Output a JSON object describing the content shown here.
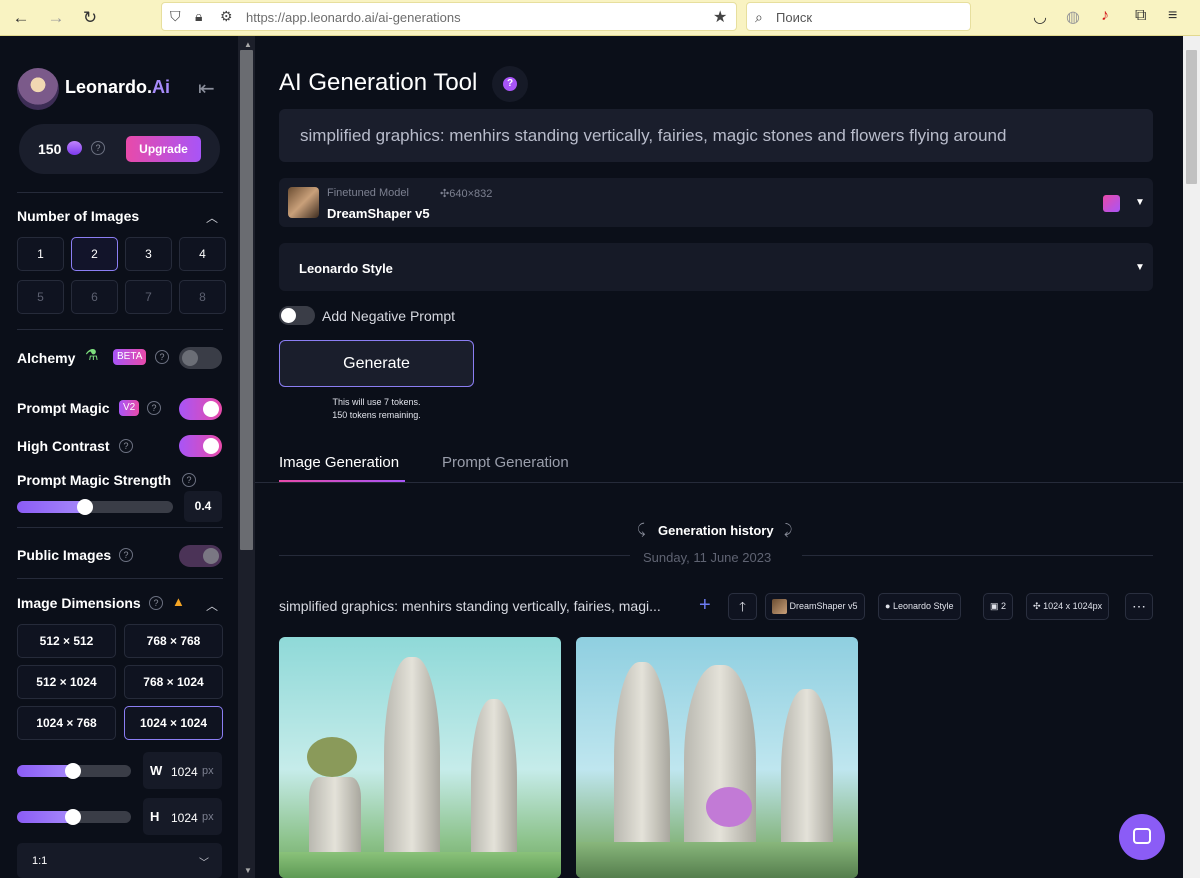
{
  "browser": {
    "url": "https://app.leonardo.ai/ai-generations",
    "search_placeholder": "Поиск"
  },
  "sidebar": {
    "brand_name": "Leonardo.",
    "brand_suffix": "Ai",
    "tokens": "150",
    "upgrade_label": "Upgrade",
    "num_images_label": "Number of Images",
    "num_options": [
      "1",
      "2",
      "3",
      "4",
      "5",
      "6",
      "7",
      "8"
    ],
    "num_selected": "2",
    "alchemy_label": "Alchemy",
    "alchemy_badge": "BETA",
    "prompt_magic_label": "Prompt Magic",
    "prompt_magic_badge": "V2",
    "high_contrast_label": "High Contrast",
    "pm_strength_label": "Prompt Magic Strength",
    "pm_strength_value": "0.4",
    "public_images_label": "Public Images",
    "image_dimensions_label": "Image Dimensions",
    "dimensions": [
      "512 × 512",
      "768 × 768",
      "512 × 1024",
      "768 × 1024",
      "1024 × 768",
      "1024 × 1024"
    ],
    "dimension_selected": "1024 × 1024",
    "w_label": "W",
    "w_value": "1024",
    "h_label": "H",
    "h_value": "1024",
    "unit": "px",
    "ratio": "1:1"
  },
  "main": {
    "title": "AI Generation Tool",
    "prompt": "simplified graphics: menhirs standing vertically, fairies, magic stones and flowers flying around",
    "model_type": "Finetuned Model",
    "model_dims": "640×832",
    "model_name": "DreamShaper v5",
    "style": "Leonardo Style",
    "negative_prompt_label": "Add Negative Prompt",
    "generate_label": "Generate",
    "token_note_1": "This will use 7 tokens.",
    "token_note_2": "150 tokens remaining.",
    "tab_image": "Image Generation",
    "tab_prompt": "Prompt Generation",
    "history_label": "Generation history",
    "history_date": "Sunday, 11 June 2023",
    "gen_title": "simplified graphics: menhirs standing vertically, fairies, magi...",
    "chip_model": "DreamShaper v5",
    "chip_style": "Leonardo Style",
    "chip_count": "2",
    "chip_size": "1024 x 1024px"
  },
  "colors": {
    "accent": "#a855f7",
    "pink": "#e84aa9",
    "background": "#0b0f19",
    "browser_bar": "#f9f3c2"
  }
}
